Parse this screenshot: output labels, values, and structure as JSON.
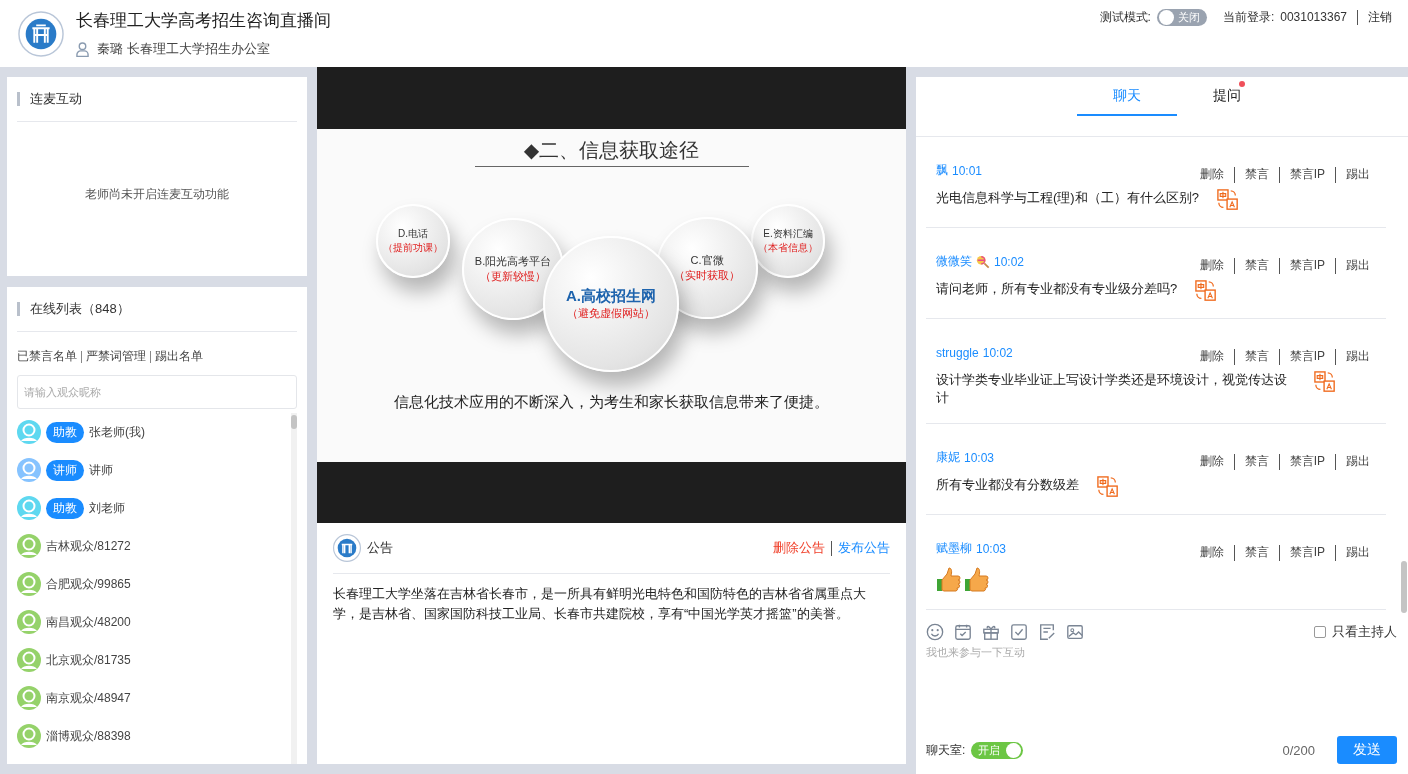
{
  "header": {
    "title": "长春理工大学高考招生咨询直播间",
    "user": "秦璐 长春理工大学招生办公室",
    "test_mode": {
      "label": "测试模式:",
      "on": false,
      "text": "关闭"
    },
    "login_label": "当前登录:",
    "login_id": "0031013367",
    "logout": "注销"
  },
  "mic_panel": {
    "title": "连麦互动",
    "message": "老师尚未开启连麦互动功能"
  },
  "online": {
    "title": "在线列表（848）",
    "links": [
      "已禁言名单",
      "严禁词管理",
      "踢出名单"
    ],
    "search_placeholder": "请输入观众昵称",
    "users": [
      {
        "name": "张老师(我)",
        "role": "助教",
        "color": "#5ed8f0"
      },
      {
        "name": "讲师",
        "role": "讲师",
        "color": "#86c3ff"
      },
      {
        "name": "刘老师",
        "role": "助教",
        "color": "#5ed8f0"
      },
      {
        "name": "吉林观众/81272",
        "color": "#95d26a"
      },
      {
        "name": "合肥观众/99865",
        "color": "#95d26a"
      },
      {
        "name": "南昌观众/48200",
        "color": "#95d26a"
      },
      {
        "name": "北京观众/81735",
        "color": "#95d26a"
      },
      {
        "name": "南京观众/48947",
        "color": "#95d26a"
      },
      {
        "name": "淄博观众/88398",
        "color": "#95d26a"
      }
    ]
  },
  "slide": {
    "title": "◆二、信息获取途径",
    "bubbles": [
      {
        "kind": "small",
        "label": "D.电话",
        "note": "（提前功课）"
      },
      {
        "kind": "medium",
        "label": "B.阳光高考平台",
        "note": "（更新较慢）"
      },
      {
        "kind": "large",
        "label": "A.高校招生网",
        "note": "（避免虚假网站）"
      },
      {
        "kind": "medium",
        "label": "C.官微",
        "note": "（实时获取）"
      },
      {
        "kind": "small",
        "label": "E.资料汇编",
        "note": "（本省信息）"
      }
    ],
    "caption": "信息化技术应用的不断深入，为考生和家长获取信息带来了便捷。"
  },
  "notice": {
    "title": "公告",
    "actions": [
      {
        "label": "删除公告",
        "kind": "danger"
      },
      {
        "label": "发布公告",
        "kind": "primary"
      }
    ],
    "body": "长春理工大学坐落在吉林省长春市，是一所具有鲜明光电特色和国防特色的吉林省省属重点大学，是吉林省、国家国防科技工业局、长春市共建院校，享有“中国光学英才摇篮”的美誉。"
  },
  "chat": {
    "tabs": [
      {
        "label": "聊天",
        "selected": true,
        "dot": false
      },
      {
        "label": "提问",
        "selected": false,
        "dot": true
      }
    ],
    "messages": [
      {
        "name": "飘",
        "time": "10:01",
        "actions": [
          "删除",
          "禁言",
          "禁言IP",
          "踢出"
        ],
        "kind": "text",
        "text": "光电信息科学与工程(理)和（工）有什么区别?",
        "translatable": true
      },
      {
        "name": "微微笑",
        "lollipop": true,
        "time": "10:02",
        "actions": [
          "删除",
          "禁言",
          "禁言IP",
          "踢出"
        ],
        "kind": "text",
        "text": "请问老师，所有专业都没有专业级分差吗?",
        "translatable": true
      },
      {
        "name": "struggle",
        "time": "10:02",
        "actions": [
          "删除",
          "禁言",
          "禁言IP",
          "踢出"
        ],
        "kind": "text",
        "text": "设计学类专业毕业证上写设计学类还是环境设计，视觉传达设计",
        "translatable": true
      },
      {
        "name": "康妮",
        "time": "10:03",
        "actions": [
          "删除",
          "禁言",
          "禁言IP",
          "踢出"
        ],
        "kind": "text",
        "text": "所有专业都没有分数级差",
        "translatable": true
      },
      {
        "name": "赋墨柳",
        "time": "10:03",
        "actions": [
          "删除",
          "禁言",
          "禁言IP",
          "踢出"
        ],
        "kind": "stickers",
        "stickers": [
          {
            "kind": "thumbs_up"
          },
          {
            "kind": "thumbs_up"
          }
        ]
      }
    ],
    "host_only": {
      "label": "只看主持人",
      "checked": false
    },
    "placeholder": "我也来参与一下互动",
    "room": {
      "label": "聊天室:",
      "on": true,
      "text": "开启"
    },
    "counter": "0/200",
    "send": "发送"
  }
}
